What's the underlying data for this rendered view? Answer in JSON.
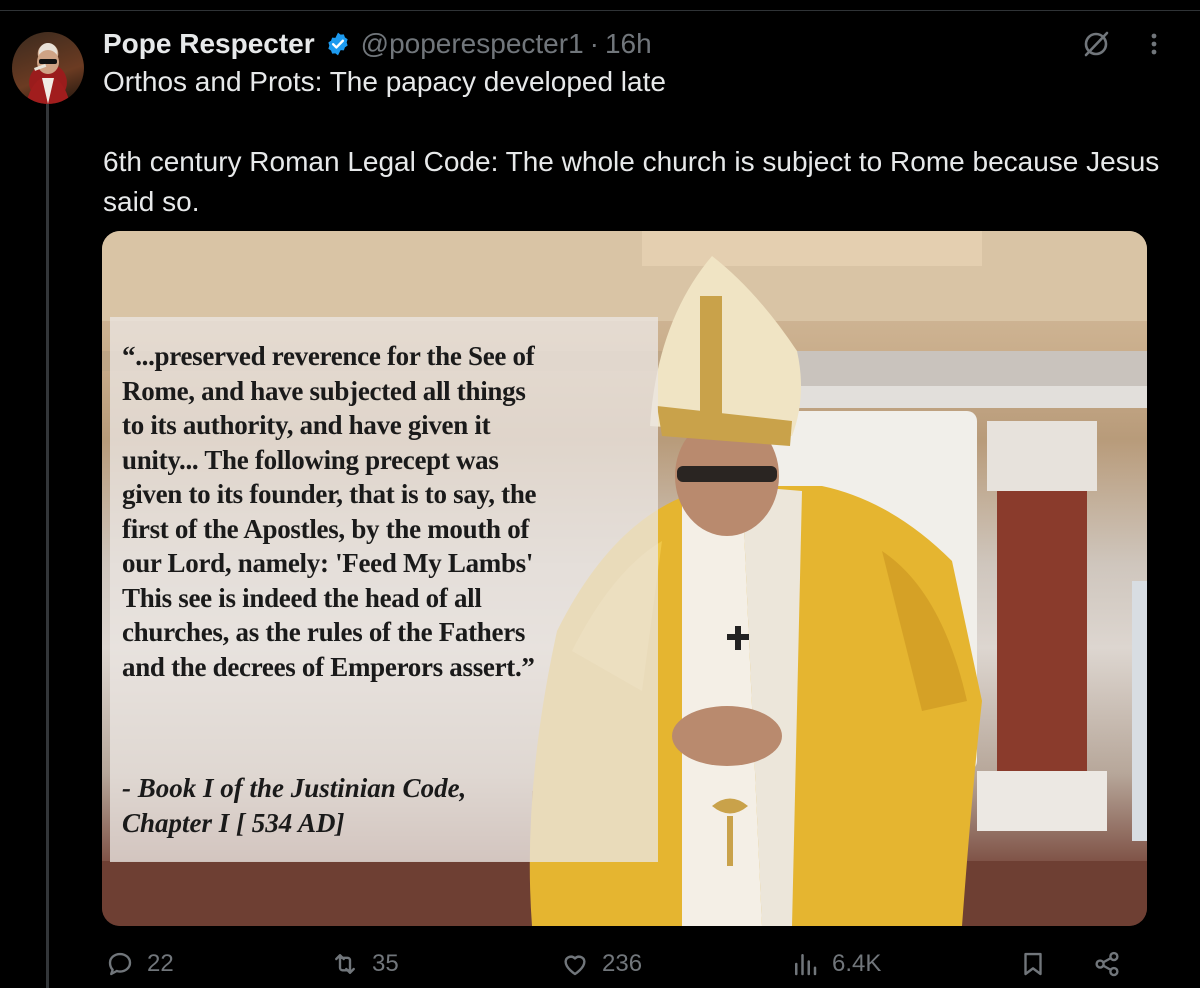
{
  "author": {
    "display_name": "Pope Respecter",
    "handle": "@poperespecter1",
    "separator": "·",
    "time": "16h",
    "verified": true
  },
  "tweet": {
    "text": "Orthos and Prots: The papacy developed late\n\n6th century Roman Legal Code: The whole church is subject to Rome because Jesus said so."
  },
  "media": {
    "quote": "“...preserved reverence for the See of\nRome, and have subjected all things\nto its authority, and have given it\nunity... The following precept was\ngiven to its founder, that is to say, the\nfirst of the Apostles, by the mouth of\nour Lord, namely: 'Feed My Lambs'\nThis see is indeed the head of all\nchurches, as the rules of the Fathers\nand the decrees of Emperors assert.”",
    "citation": "- Book I of the Justinian Code,\nChapter I [ 534 AD]"
  },
  "actions": {
    "replies": "22",
    "reposts": "35",
    "likes": "236",
    "views": "6.4K"
  },
  "colors": {
    "background": "#000000",
    "text": "#e7e9ea",
    "muted": "#71767b",
    "verified": "#1d9bf0"
  },
  "icons": [
    "avatar",
    "verified-badge-icon",
    "grok-icon",
    "more-icon",
    "reply-icon",
    "repost-icon",
    "like-icon",
    "views-icon",
    "bookmark-icon",
    "share-icon"
  ]
}
